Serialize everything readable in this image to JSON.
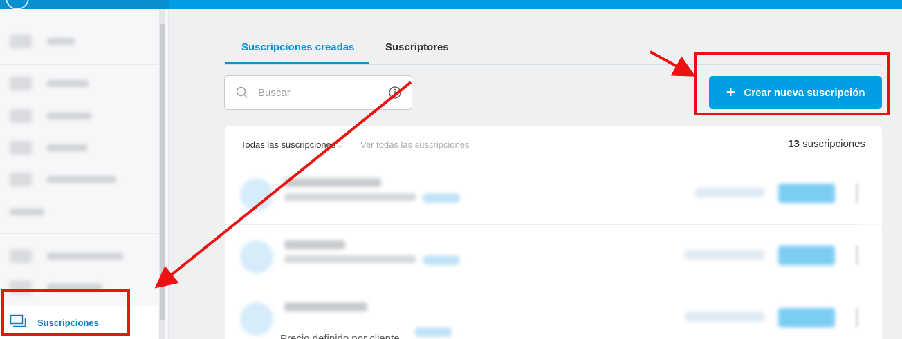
{
  "colors": {
    "accent": "#009ee3",
    "annotation": "#ee1111"
  },
  "sidebar": {
    "active_item": {
      "label": "Suscripciones",
      "icon": "subscriptions-icon"
    }
  },
  "tabs": [
    {
      "label": "Suscripciones creadas",
      "active": true
    },
    {
      "label": "Suscriptores",
      "active": false
    }
  ],
  "search": {
    "placeholder": "Buscar",
    "icon": "search-icon",
    "info_icon": "info-icon"
  },
  "create_button": {
    "label": "Crear nueva suscripción",
    "icon": "plus-icon"
  },
  "list": {
    "filter_label": "Todas las suscripciones",
    "view_all_label": "Ver todas las suscripciones",
    "count_number": "13",
    "count_label": "suscripciones",
    "partial_row_text": "Precio definido por cliente"
  }
}
